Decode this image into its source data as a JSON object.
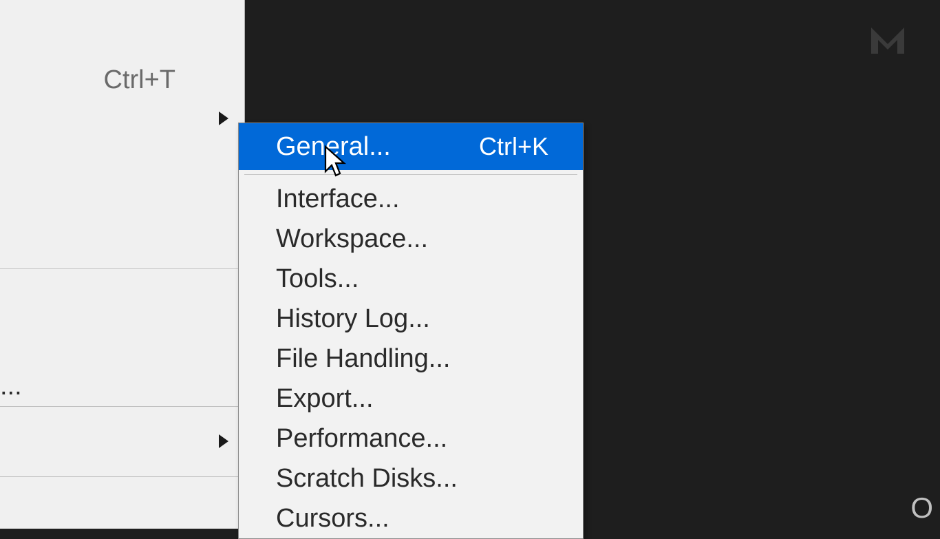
{
  "left_menu": {
    "shortcut_visible": "Ctrl+T",
    "partial_text": "..."
  },
  "submenu": {
    "items": [
      {
        "label": "General...",
        "shortcut": "Ctrl+K",
        "highlighted": true
      },
      {
        "label": "Interface...",
        "shortcut": ""
      },
      {
        "label": "Workspace...",
        "shortcut": ""
      },
      {
        "label": "Tools...",
        "shortcut": ""
      },
      {
        "label": "History Log...",
        "shortcut": ""
      },
      {
        "label": "File Handling...",
        "shortcut": ""
      },
      {
        "label": "Export...",
        "shortcut": ""
      },
      {
        "label": "Performance...",
        "shortcut": ""
      },
      {
        "label": "Scratch Disks...",
        "shortcut": ""
      },
      {
        "label": "Cursors...",
        "shortcut": ""
      }
    ]
  },
  "corner": {
    "letter": "O"
  }
}
